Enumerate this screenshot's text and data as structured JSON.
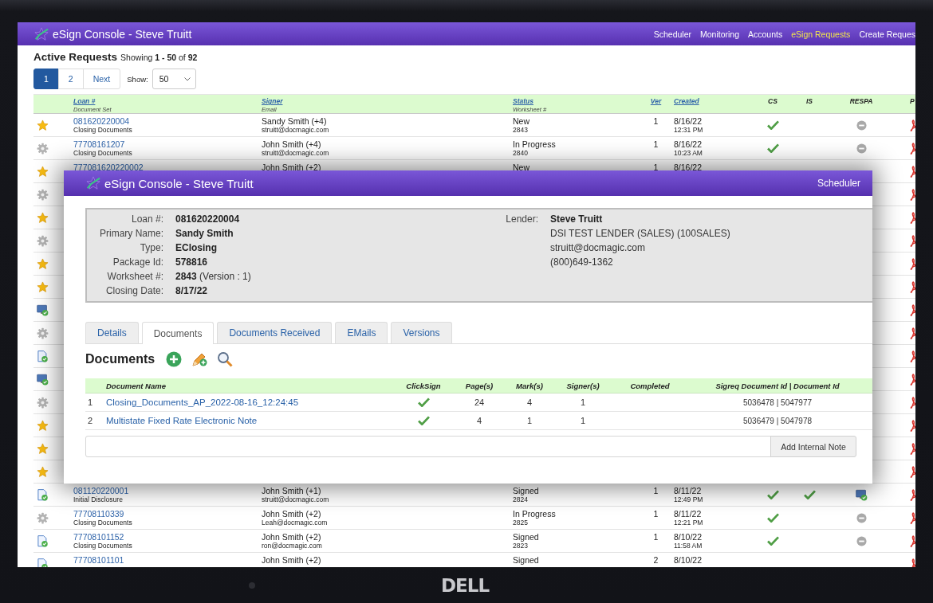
{
  "app": {
    "title": "eSign Console - Steve Truitt",
    "nav": [
      {
        "label": "Scheduler",
        "selected": false
      },
      {
        "label": "Monitoring",
        "selected": false
      },
      {
        "label": "Accounts",
        "selected": false
      },
      {
        "label": "eSign Requests",
        "selected": true
      },
      {
        "label": "Create Reques",
        "selected": false
      }
    ]
  },
  "requests": {
    "heading": "Active Requests",
    "summary": "Showing **1 - 50** of **92**",
    "pages": [
      {
        "label": "1",
        "selected": true
      },
      {
        "label": "2",
        "selected": false
      },
      {
        "label": "Next",
        "selected": false
      }
    ],
    "show_label": "Show:",
    "show_value": "50",
    "columns": [
      {
        "label": "Loan #",
        "sub": "Document Set",
        "kind": "sort"
      },
      {
        "label": "Signer",
        "sub": "Email",
        "kind": "sort"
      },
      {
        "label": "Status",
        "sub": "Worksheet #",
        "kind": "sort"
      },
      {
        "label": "Ver",
        "kind": "sort"
      },
      {
        "label": "Created",
        "kind": "sort"
      },
      {
        "label": "CS",
        "kind": "plain"
      },
      {
        "label": "IS",
        "kind": "plain"
      },
      {
        "label": "RESPA",
        "kind": "plain"
      },
      {
        "label": "P",
        "kind": "plain"
      }
    ],
    "rows": [
      {
        "kind": "star",
        "loan": "081620220004",
        "doc_set": "Closing Documents",
        "signer": "Sandy Smith (+4)",
        "email": "struitt@docmagic.com",
        "status": "New",
        "worksheet": "2843",
        "ver": "1",
        "date": "8/16/22",
        "time": "12:31 PM",
        "cs": true,
        "is": false,
        "respa_complete": false
      },
      {
        "kind": "gear",
        "loan": "77708161207",
        "doc_set": "Closing Documents",
        "signer": "John Smith (+4)",
        "email": "struitt@docmagic.com",
        "status": "In Progress",
        "worksheet": "2840",
        "ver": "1",
        "date": "8/16/22",
        "time": "10:23 AM",
        "cs": true,
        "is": false,
        "respa_complete": false
      },
      {
        "kind": "star",
        "loan": "777081620220002",
        "signer": "John Smith (+2)",
        "status": "New",
        "ver": "1",
        "date": "8/16/22"
      },
      {
        "kind": "gear"
      },
      {
        "kind": "star"
      },
      {
        "kind": "gear"
      },
      {
        "kind": "star"
      },
      {
        "kind": "star"
      },
      {
        "kind": "monitor"
      },
      {
        "kind": "gear"
      },
      {
        "kind": "doc"
      },
      {
        "kind": "monitor"
      },
      {
        "kind": "gear"
      },
      {
        "kind": "star"
      },
      {
        "kind": "star"
      },
      {
        "kind": "star"
      },
      {
        "kind": "doc",
        "loan": "081120220001",
        "doc_set": "Initial Disclosure",
        "signer": "John Smith (+1)",
        "email": "struitt@docmagic.com",
        "status": "Signed",
        "worksheet": "2824",
        "ver": "1",
        "date": "8/11/22",
        "time": "12:49 PM",
        "cs": true,
        "is": true,
        "respa_complete": true
      },
      {
        "kind": "gear",
        "loan": "77708110339",
        "doc_set": "Closing Documents",
        "signer": "John Smith (+2)",
        "email": "Leah@docmagic.com",
        "status": "In Progress",
        "worksheet": "2825",
        "ver": "1",
        "date": "8/11/22",
        "time": "12:21 PM",
        "cs": true,
        "is": false,
        "respa_complete": false
      },
      {
        "kind": "doc",
        "loan": "77708101152",
        "doc_set": "Closing Documents",
        "signer": "John Smith (+2)",
        "email": "ron@docmagic.com",
        "status": "Signed",
        "worksheet": "2823",
        "ver": "1",
        "date": "8/10/22",
        "time": "11:58 AM",
        "cs": true,
        "is": false,
        "respa_complete": false
      },
      {
        "kind": "doc",
        "loan": "77708101101",
        "signer": "John Smith (+2)",
        "status": "Signed",
        "ver": "2",
        "date": "8/10/22"
      }
    ]
  },
  "dialog": {
    "title": "eSign Console - Steve Truitt",
    "nav": [
      {
        "label": "Scheduler",
        "selected": false
      }
    ],
    "details": [
      {
        "label": "Loan #:",
        "value": "081620220004"
      },
      {
        "label": "Primary Name:",
        "value": "Sandy Smith"
      },
      {
        "label": "Type:",
        "value": "EClosing"
      },
      {
        "label": "Package Id:",
        "value": "578816"
      },
      {
        "label": "Worksheet #:",
        "value": "2843",
        "note": "(Version : 1)"
      },
      {
        "label": "Closing Date:",
        "value": "8/17/22"
      }
    ],
    "lender": {
      "label": "Lender:",
      "name": "Steve Truitt",
      "lines": [
        "DSI TEST LENDER (SALES) (100SALES)",
        "struitt@docmagic.com",
        "(800)649-1362"
      ]
    },
    "tabs": [
      {
        "label": "Details",
        "selected": false
      },
      {
        "label": "Documents",
        "selected": true
      },
      {
        "label": "Documents Received",
        "selected": false
      },
      {
        "label": "EMails",
        "selected": false
      },
      {
        "label": "Versions",
        "selected": false
      }
    ],
    "section_title": "Documents",
    "doc_columns": [
      "Document Name",
      "ClickSign",
      "Page(s)",
      "Mark(s)",
      "Signer(s)",
      "Completed",
      "Sigreq Document Id | Document Id"
    ],
    "documents": [
      {
        "number": "1",
        "name": "Closing_Documents_AP_2022-08-16_12:24:45",
        "clicksign": true,
        "pages": "24",
        "marks": "4",
        "signers": "1",
        "ids": "5036478 | 5047977"
      },
      {
        "number": "2",
        "name": "Multistate Fixed Rate Electronic Note",
        "clicksign": true,
        "pages": "4",
        "marks": "1",
        "signers": "1",
        "ids": "5036479 | 5047978"
      }
    ],
    "note_button": "Add Internal Note"
  },
  "device": {
    "logo": "DELL"
  }
}
